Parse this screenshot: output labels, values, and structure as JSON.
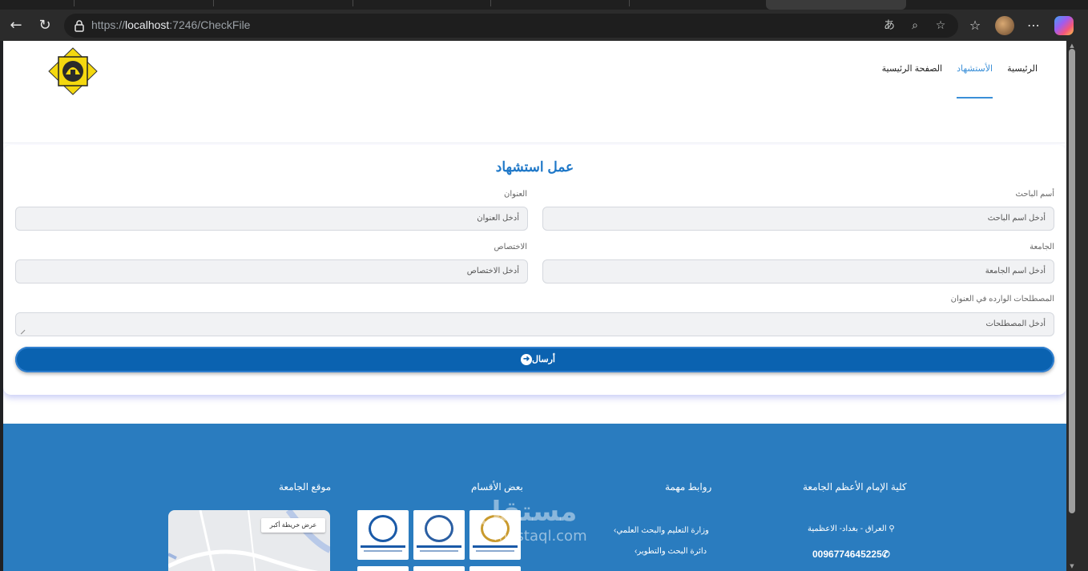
{
  "browser": {
    "url_prefix": "https://",
    "url_host": "localhost",
    "url_rest": ":7246/CheckFile"
  },
  "nav": {
    "items": [
      {
        "label": "الرئيسية"
      },
      {
        "label": "الأستشهاد"
      },
      {
        "label": "الصفحة الرئيسية"
      }
    ],
    "active_index": 1
  },
  "form": {
    "title": "عمل استشهاد",
    "researcher_label": "أسم الباحث",
    "researcher_placeholder": "أدخل اسم الباحث",
    "title_label": "العنوان",
    "title_placeholder": "أدخل العنوان",
    "university_label": "الجامعة",
    "university_placeholder": "أدخل اسم الجامعة",
    "specialization_label": "الاختصاص",
    "specialization_placeholder": "أدخل الاختصاص",
    "terms_label": "المصطلحات الوارده في العنوان",
    "terms_placeholder": "أدخل المصطلحات",
    "submit_label": "أرسال"
  },
  "footer": {
    "college_title": "كلية الإمام الأعظم الجامعة",
    "address": "العراق - بغداد- الاعظمية",
    "phone": "0096774645225",
    "links_title": "روابط مهمة",
    "links": [
      {
        "label": "وزارة التعليم والبحث العلمي"
      },
      {
        "label": "دائرة البحث والتطوير"
      }
    ],
    "departments_title": "بعض الأقسام",
    "map_title": "موقع الجامعة",
    "map_button": "عرض خريطة أكبر",
    "watermark": "مستقل",
    "watermark_url": "mostaql.com"
  },
  "colors": {
    "accent": "#1f78c8",
    "button": "#0a62b0",
    "footer": "#2a7cbf"
  }
}
